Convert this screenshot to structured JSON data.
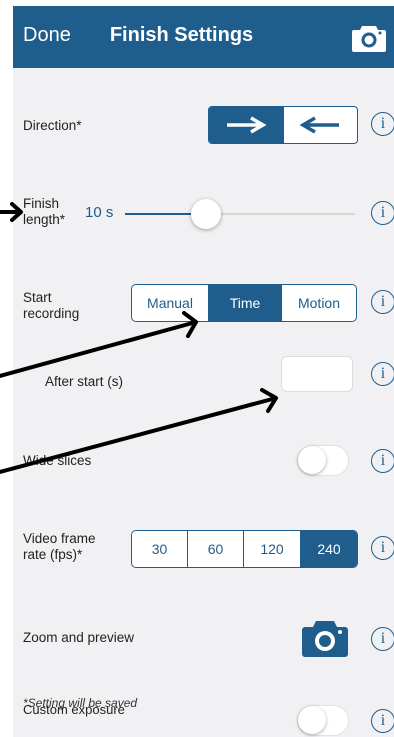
{
  "nav": {
    "done": "Done",
    "title": "Finish Settings",
    "camera_icon": "camera-icon"
  },
  "direction": {
    "label": "Direction*",
    "options": [
      "right-arrow-icon",
      "left-arrow-icon"
    ],
    "selected": 0
  },
  "finish_length": {
    "label_line1": "Finish",
    "label_line2": "length*",
    "value": "10 s",
    "slider_fraction": 0.33
  },
  "start_recording": {
    "label_line1": "Start",
    "label_line2": "recording",
    "options": [
      "Manual",
      "Time",
      "Motion"
    ],
    "selected": "Time"
  },
  "after_start": {
    "label": "After start (s)",
    "value": ""
  },
  "wide_slices": {
    "label": "Wide slices",
    "on": false
  },
  "video_frame_rate": {
    "label_line1": "Video frame",
    "label_line2": "rate (fps)*",
    "options": [
      "30",
      "60",
      "120",
      "240"
    ],
    "selected": "240"
  },
  "zoom_preview": {
    "label": "Zoom and preview"
  },
  "custom_exposure": {
    "label": "Custom exposure",
    "on": false
  },
  "footnote": "*Setting will be saved",
  "info_glyph": "i",
  "colors": {
    "accent": "#1f5d8c",
    "background": "#f1f1f3",
    "annotation_arrow": "#000000"
  }
}
